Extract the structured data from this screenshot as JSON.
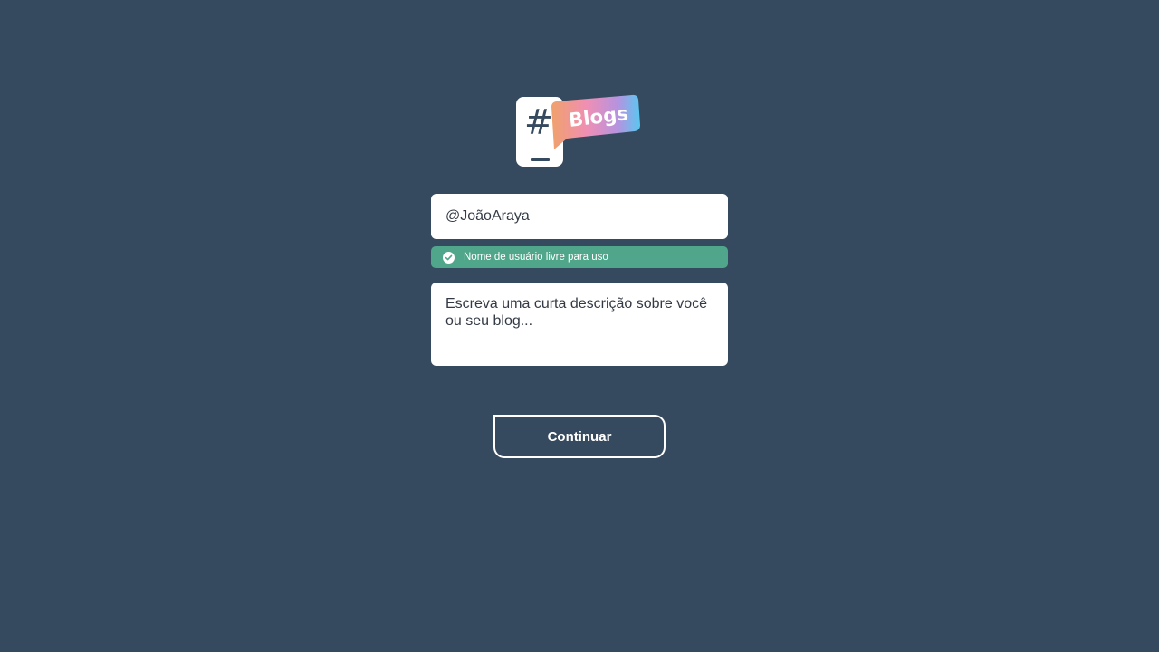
{
  "logo": {
    "symbol": "#",
    "word": "Blogs",
    "ribbon_gradient": [
      "#f0a16b",
      "#ef8fb4",
      "#9d98ea",
      "#59c8f0"
    ]
  },
  "form": {
    "username_value": "@JoãoAraya",
    "status": {
      "icon": "check-circle-icon",
      "text": "Nome de usuário livre para uso",
      "color": "#50a68a"
    },
    "description_placeholder": "Escreva uma curta descrição sobre você ou seu blog..."
  },
  "actions": {
    "continue_label": "Continuar"
  },
  "colors": {
    "background": "#364a5f",
    "field_background": "#ffffff",
    "text": "#333a44"
  }
}
